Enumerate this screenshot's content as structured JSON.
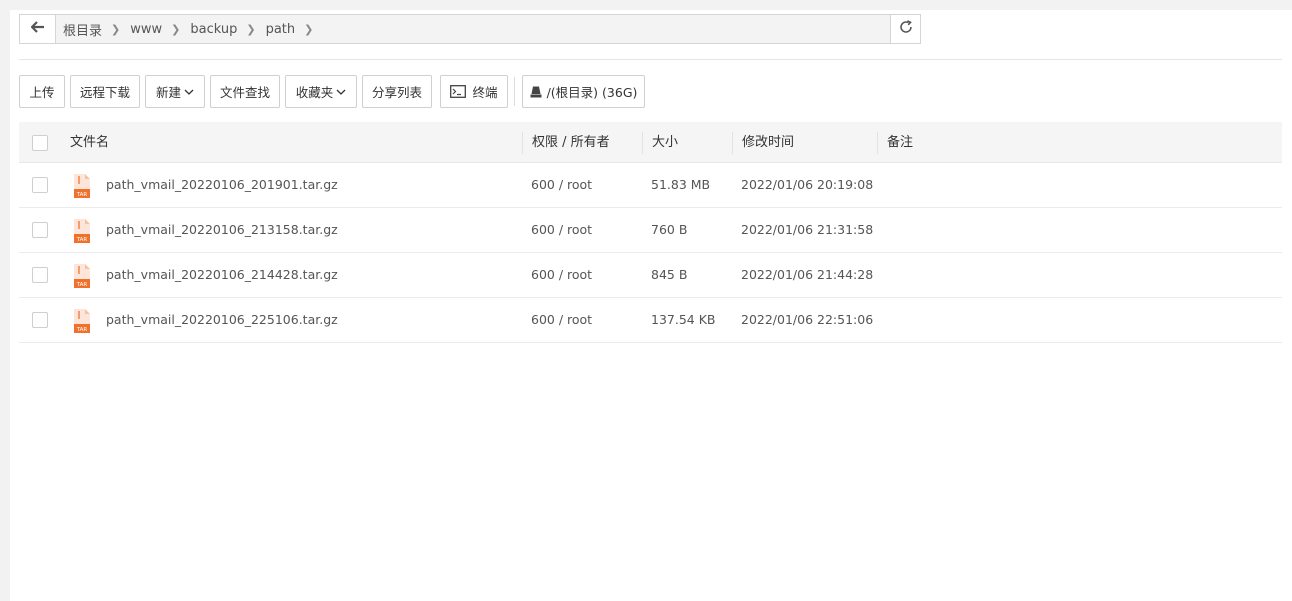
{
  "pathbar": {
    "crumbs": [
      "根目录",
      "www",
      "backup",
      "path"
    ]
  },
  "toolbar": {
    "upload": "上传",
    "remote_download": "远程下载",
    "new": "新建",
    "file_search": "文件查找",
    "favorites": "收藏夹",
    "share_list": "分享列表",
    "terminal": "终端",
    "disk": "/(根目录) (36G)"
  },
  "table": {
    "headers": {
      "name": "文件名",
      "perm_owner": "权限 / 所有者",
      "size": "大小",
      "mtime": "修改时间",
      "remark": "备注"
    },
    "rows": [
      {
        "name": "path_vmail_20220106_201901.tar.gz",
        "perm": "600 / root",
        "size": "51.83 MB",
        "mtime": "2022/01/06 20:19:08",
        "remark": ""
      },
      {
        "name": "path_vmail_20220106_213158.tar.gz",
        "perm": "600 / root",
        "size": "760 B",
        "mtime": "2022/01/06 21:31:58",
        "remark": ""
      },
      {
        "name": "path_vmail_20220106_214428.tar.gz",
        "perm": "600 / root",
        "size": "845 B",
        "mtime": "2022/01/06 21:44:28",
        "remark": ""
      },
      {
        "name": "path_vmail_20220106_225106.tar.gz",
        "perm": "600 / root",
        "size": "137.54 KB",
        "mtime": "2022/01/06 22:51:06",
        "remark": ""
      }
    ],
    "file_icon_label": "TAR"
  },
  "icons": {
    "back": "arrow-left-icon",
    "refresh": "refresh-icon",
    "terminal": "terminal-icon",
    "disk": "disk-icon",
    "file": "tar-file-icon"
  },
  "colors": {
    "accent_file": "#f0712c"
  }
}
